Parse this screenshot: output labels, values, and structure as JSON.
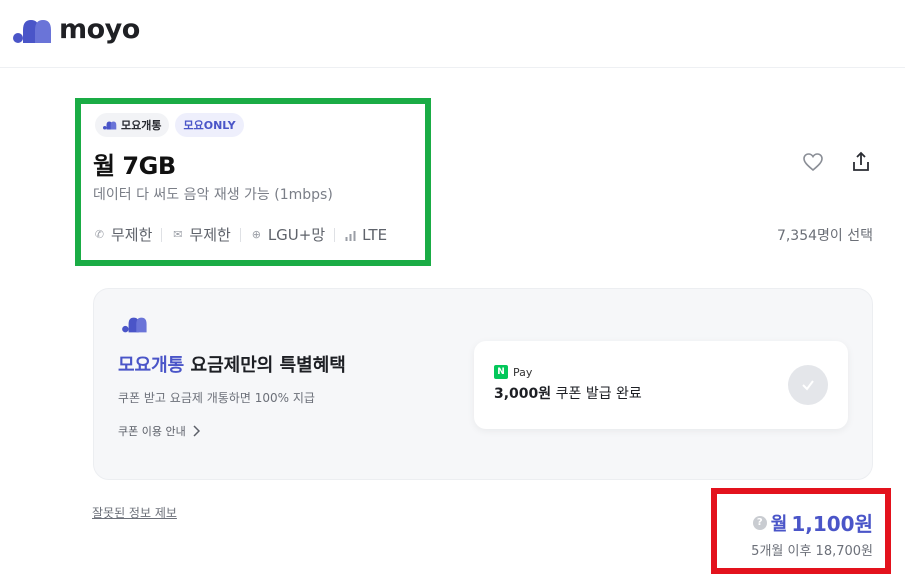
{
  "brand": {
    "name": "moyo",
    "accent": "#4a55c8"
  },
  "plan": {
    "tags": [
      "모요개통",
      "모요ONLY"
    ],
    "title": "월 7GB",
    "subtitle": "데이터 다 써도 음악 재생 가능 (1mbps)",
    "specs": [
      {
        "icon": "phone-icon",
        "label": "무제한"
      },
      {
        "icon": "message-icon",
        "label": "무제한"
      },
      {
        "icon": "globe-icon",
        "label": "LGU+망"
      },
      {
        "icon": "signal-icon",
        "label": "LTE"
      }
    ],
    "selected_count": "7,354명이 선택"
  },
  "promo": {
    "title_accent": "모요개통",
    "title_rest": " 요금제만의 특별혜택",
    "description": "쿠폰 받고 요금제 개통하면 100% 지급",
    "link": "쿠폰 이용 안내",
    "coupon": {
      "pay_label": "Pay",
      "n_label": "N",
      "amount": "3,000원",
      "text": " 쿠폰 발급 완료"
    }
  },
  "report_link": "잘못된 정보 제보",
  "price": {
    "help": "?",
    "prefix": "월",
    "value": "1,100원",
    "after": "5개월 이후 18,700원"
  },
  "colors": {
    "green_highlight": "#1aac45",
    "red_highlight": "#e3121d",
    "npay_green": "#03c75a"
  }
}
